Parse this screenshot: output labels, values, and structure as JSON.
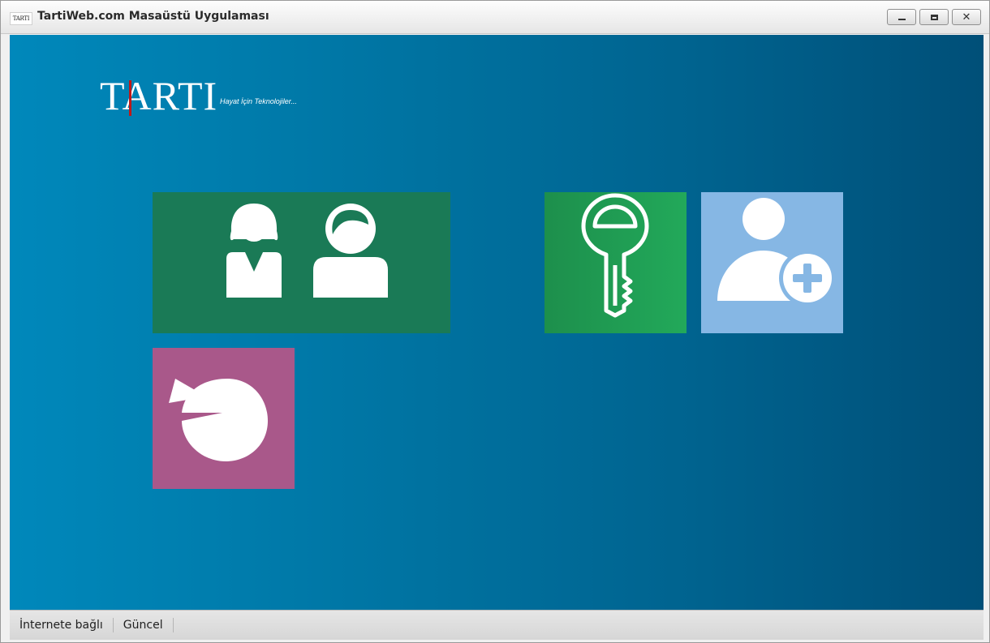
{
  "window": {
    "icon_text": "TARTI",
    "title": "TartiWeb.com Masaüstü Uygulaması",
    "minimize_glyph": "",
    "maximize_glyph": "",
    "close_glyph": "✕"
  },
  "logo": {
    "text": "TARTI",
    "tagline": "Hayat İçin Teknolojiler..."
  },
  "tiles": [
    {
      "id": "users",
      "icon": "users-icon",
      "color": "#1a7a56"
    },
    {
      "id": "key",
      "icon": "key-icon",
      "color": "#1f9e50"
    },
    {
      "id": "add-user",
      "icon": "add-user-icon",
      "color": "#86b7e4"
    },
    {
      "id": "reports",
      "icon": "pie-chart-icon",
      "color": "#a9588a"
    }
  ],
  "status": {
    "connection": "İnternete bağlı",
    "update": "Güncel"
  }
}
